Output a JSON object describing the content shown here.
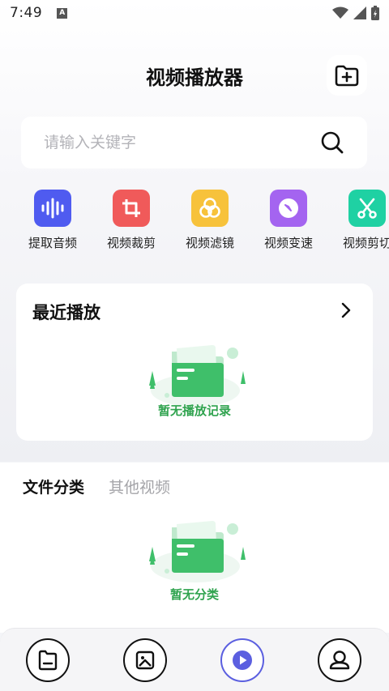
{
  "status_bar": {
    "time": "7:49",
    "indicator": "A"
  },
  "header": {
    "title": "视频播放器",
    "add_folder_icon": "folder-plus-icon"
  },
  "search": {
    "placeholder": "请输入关键字",
    "value": "",
    "icon": "search-icon"
  },
  "tools": [
    {
      "label": "提取音频",
      "icon": "audio-wave-icon",
      "color": "#4f5bf0"
    },
    {
      "label": "视频裁剪",
      "icon": "crop-icon",
      "color": "#f05a5a"
    },
    {
      "label": "视频滤镜",
      "icon": "filter-icon",
      "color": "#f7c23b"
    },
    {
      "label": "视频变速",
      "icon": "speed-icon",
      "color": "#a464f0"
    },
    {
      "label": "视频剪切",
      "icon": "scissors-icon",
      "color": "#1fd1a3"
    }
  ],
  "recent": {
    "title": "最近播放",
    "empty_text": "暂无播放记录"
  },
  "category": {
    "tabs": [
      "文件分类",
      "其他视频"
    ],
    "active_tab": "文件分类",
    "empty_text": "暂无分类"
  },
  "bottom_nav": [
    {
      "icon": "folder-icon",
      "active": false
    },
    {
      "icon": "image-icon",
      "active": false
    },
    {
      "icon": "play-icon",
      "active": true
    },
    {
      "icon": "user-icon",
      "active": false
    }
  ],
  "colors": {
    "accent": "#5b5fe0",
    "empty_green": "#2fa34e"
  }
}
